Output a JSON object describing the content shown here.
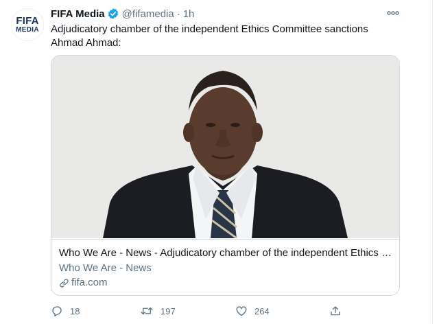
{
  "colors": {
    "brand_dark": "#16325c",
    "verified": "#1da1f2",
    "muted": "#5b7083"
  },
  "tweet": {
    "avatar": {
      "logo_line1": "FIFA",
      "logo_line2": "MEDIA"
    },
    "author_name": "FIFA Media",
    "verified": true,
    "handle": "@fifamedia",
    "separator": "·",
    "time": "1h",
    "text": "Adjudicatory chamber of the independent Ethics Committee sanctions Ahmad Ahmad:",
    "card": {
      "title": "Who We Are - News - Adjudicatory chamber of the independent Ethics Committee sanctions Ahmad Ahmad",
      "description": "Who We Are - News",
      "domain": "fifa.com"
    },
    "actions": {
      "reply_count": "18",
      "retweet_count": "197",
      "like_count": "264"
    }
  },
  "icons": [
    "verified-badge-icon",
    "more-icon",
    "link-icon",
    "reply-icon",
    "retweet-icon",
    "like-icon",
    "share-icon"
  ]
}
